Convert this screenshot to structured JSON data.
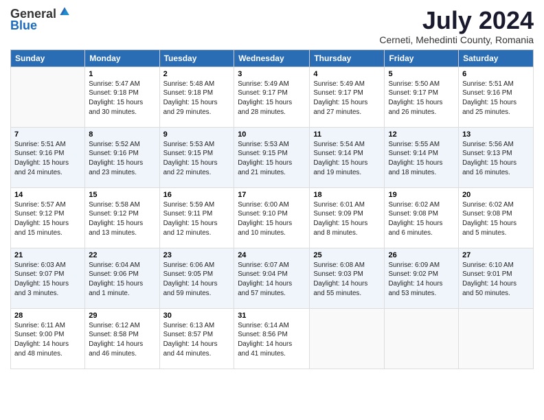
{
  "logo": {
    "general": "General",
    "blue": "Blue"
  },
  "title": {
    "month_year": "July 2024",
    "location": "Cerneti, Mehedinti County, Romania"
  },
  "weekdays": [
    "Sunday",
    "Monday",
    "Tuesday",
    "Wednesday",
    "Thursday",
    "Friday",
    "Saturday"
  ],
  "weeks": [
    [
      {
        "day": "",
        "content": ""
      },
      {
        "day": "1",
        "content": "Sunrise: 5:47 AM\nSunset: 9:18 PM\nDaylight: 15 hours\nand 30 minutes."
      },
      {
        "day": "2",
        "content": "Sunrise: 5:48 AM\nSunset: 9:18 PM\nDaylight: 15 hours\nand 29 minutes."
      },
      {
        "day": "3",
        "content": "Sunrise: 5:49 AM\nSunset: 9:17 PM\nDaylight: 15 hours\nand 28 minutes."
      },
      {
        "day": "4",
        "content": "Sunrise: 5:49 AM\nSunset: 9:17 PM\nDaylight: 15 hours\nand 27 minutes."
      },
      {
        "day": "5",
        "content": "Sunrise: 5:50 AM\nSunset: 9:17 PM\nDaylight: 15 hours\nand 26 minutes."
      },
      {
        "day": "6",
        "content": "Sunrise: 5:51 AM\nSunset: 9:16 PM\nDaylight: 15 hours\nand 25 minutes."
      }
    ],
    [
      {
        "day": "7",
        "content": "Sunrise: 5:51 AM\nSunset: 9:16 PM\nDaylight: 15 hours\nand 24 minutes."
      },
      {
        "day": "8",
        "content": "Sunrise: 5:52 AM\nSunset: 9:16 PM\nDaylight: 15 hours\nand 23 minutes."
      },
      {
        "day": "9",
        "content": "Sunrise: 5:53 AM\nSunset: 9:15 PM\nDaylight: 15 hours\nand 22 minutes."
      },
      {
        "day": "10",
        "content": "Sunrise: 5:53 AM\nSunset: 9:15 PM\nDaylight: 15 hours\nand 21 minutes."
      },
      {
        "day": "11",
        "content": "Sunrise: 5:54 AM\nSunset: 9:14 PM\nDaylight: 15 hours\nand 19 minutes."
      },
      {
        "day": "12",
        "content": "Sunrise: 5:55 AM\nSunset: 9:14 PM\nDaylight: 15 hours\nand 18 minutes."
      },
      {
        "day": "13",
        "content": "Sunrise: 5:56 AM\nSunset: 9:13 PM\nDaylight: 15 hours\nand 16 minutes."
      }
    ],
    [
      {
        "day": "14",
        "content": "Sunrise: 5:57 AM\nSunset: 9:12 PM\nDaylight: 15 hours\nand 15 minutes."
      },
      {
        "day": "15",
        "content": "Sunrise: 5:58 AM\nSunset: 9:12 PM\nDaylight: 15 hours\nand 13 minutes."
      },
      {
        "day": "16",
        "content": "Sunrise: 5:59 AM\nSunset: 9:11 PM\nDaylight: 15 hours\nand 12 minutes."
      },
      {
        "day": "17",
        "content": "Sunrise: 6:00 AM\nSunset: 9:10 PM\nDaylight: 15 hours\nand 10 minutes."
      },
      {
        "day": "18",
        "content": "Sunrise: 6:01 AM\nSunset: 9:09 PM\nDaylight: 15 hours\nand 8 minutes."
      },
      {
        "day": "19",
        "content": "Sunrise: 6:02 AM\nSunset: 9:08 PM\nDaylight: 15 hours\nand 6 minutes."
      },
      {
        "day": "20",
        "content": "Sunrise: 6:02 AM\nSunset: 9:08 PM\nDaylight: 15 hours\nand 5 minutes."
      }
    ],
    [
      {
        "day": "21",
        "content": "Sunrise: 6:03 AM\nSunset: 9:07 PM\nDaylight: 15 hours\nand 3 minutes."
      },
      {
        "day": "22",
        "content": "Sunrise: 6:04 AM\nSunset: 9:06 PM\nDaylight: 15 hours\nand 1 minute."
      },
      {
        "day": "23",
        "content": "Sunrise: 6:06 AM\nSunset: 9:05 PM\nDaylight: 14 hours\nand 59 minutes."
      },
      {
        "day": "24",
        "content": "Sunrise: 6:07 AM\nSunset: 9:04 PM\nDaylight: 14 hours\nand 57 minutes."
      },
      {
        "day": "25",
        "content": "Sunrise: 6:08 AM\nSunset: 9:03 PM\nDaylight: 14 hours\nand 55 minutes."
      },
      {
        "day": "26",
        "content": "Sunrise: 6:09 AM\nSunset: 9:02 PM\nDaylight: 14 hours\nand 53 minutes."
      },
      {
        "day": "27",
        "content": "Sunrise: 6:10 AM\nSunset: 9:01 PM\nDaylight: 14 hours\nand 50 minutes."
      }
    ],
    [
      {
        "day": "28",
        "content": "Sunrise: 6:11 AM\nSunset: 9:00 PM\nDaylight: 14 hours\nand 48 minutes."
      },
      {
        "day": "29",
        "content": "Sunrise: 6:12 AM\nSunset: 8:58 PM\nDaylight: 14 hours\nand 46 minutes."
      },
      {
        "day": "30",
        "content": "Sunrise: 6:13 AM\nSunset: 8:57 PM\nDaylight: 14 hours\nand 44 minutes."
      },
      {
        "day": "31",
        "content": "Sunrise: 6:14 AM\nSunset: 8:56 PM\nDaylight: 14 hours\nand 41 minutes."
      },
      {
        "day": "",
        "content": ""
      },
      {
        "day": "",
        "content": ""
      },
      {
        "day": "",
        "content": ""
      }
    ]
  ]
}
